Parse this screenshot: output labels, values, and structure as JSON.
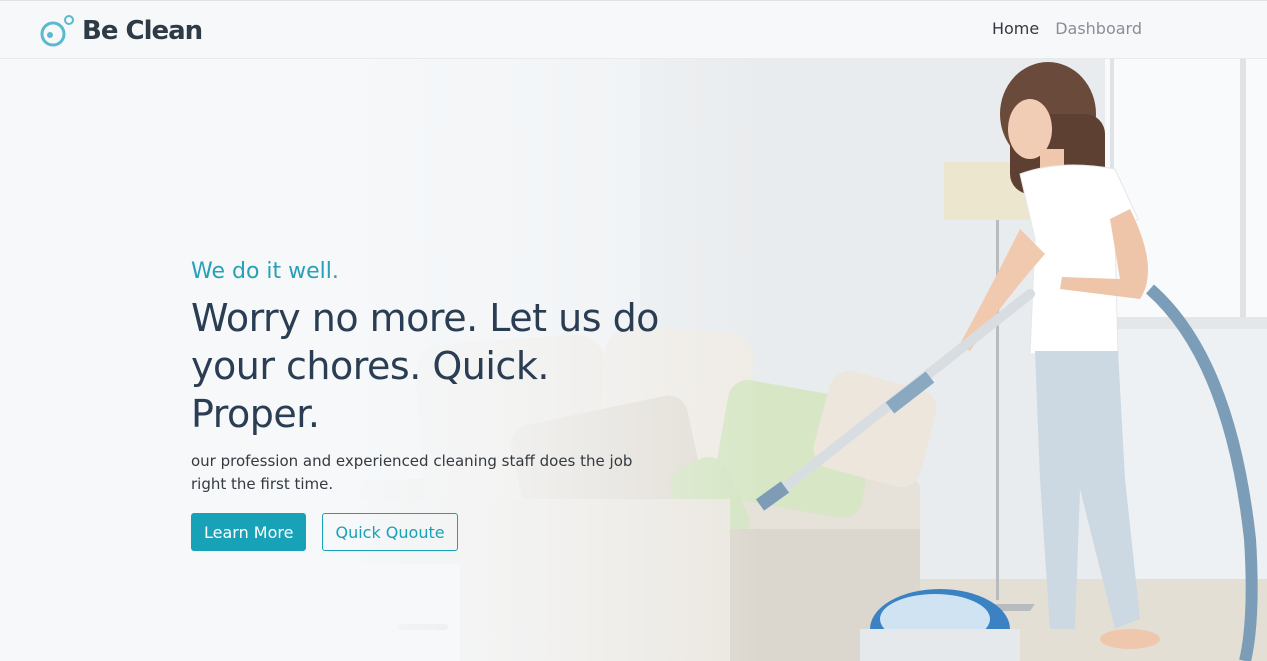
{
  "brand": {
    "name": "Be Clean",
    "accent": "#5bb9cf",
    "icon": "bubbles-logo-icon"
  },
  "nav": {
    "items": [
      {
        "label": "Home",
        "active": true
      },
      {
        "label": "Dashboard",
        "active": false
      }
    ]
  },
  "hero": {
    "tagline": "We do it well.",
    "headline": "Worry no more. Let us do your chores. Quick. Proper.",
    "subtext": "our profession and experienced cleaning staff does the job right the first time.",
    "primary_button": "Learn More",
    "secondary_button": "Quick Quoute",
    "accent_color": "#17a2b8",
    "heading_color": "#2a3d52"
  }
}
